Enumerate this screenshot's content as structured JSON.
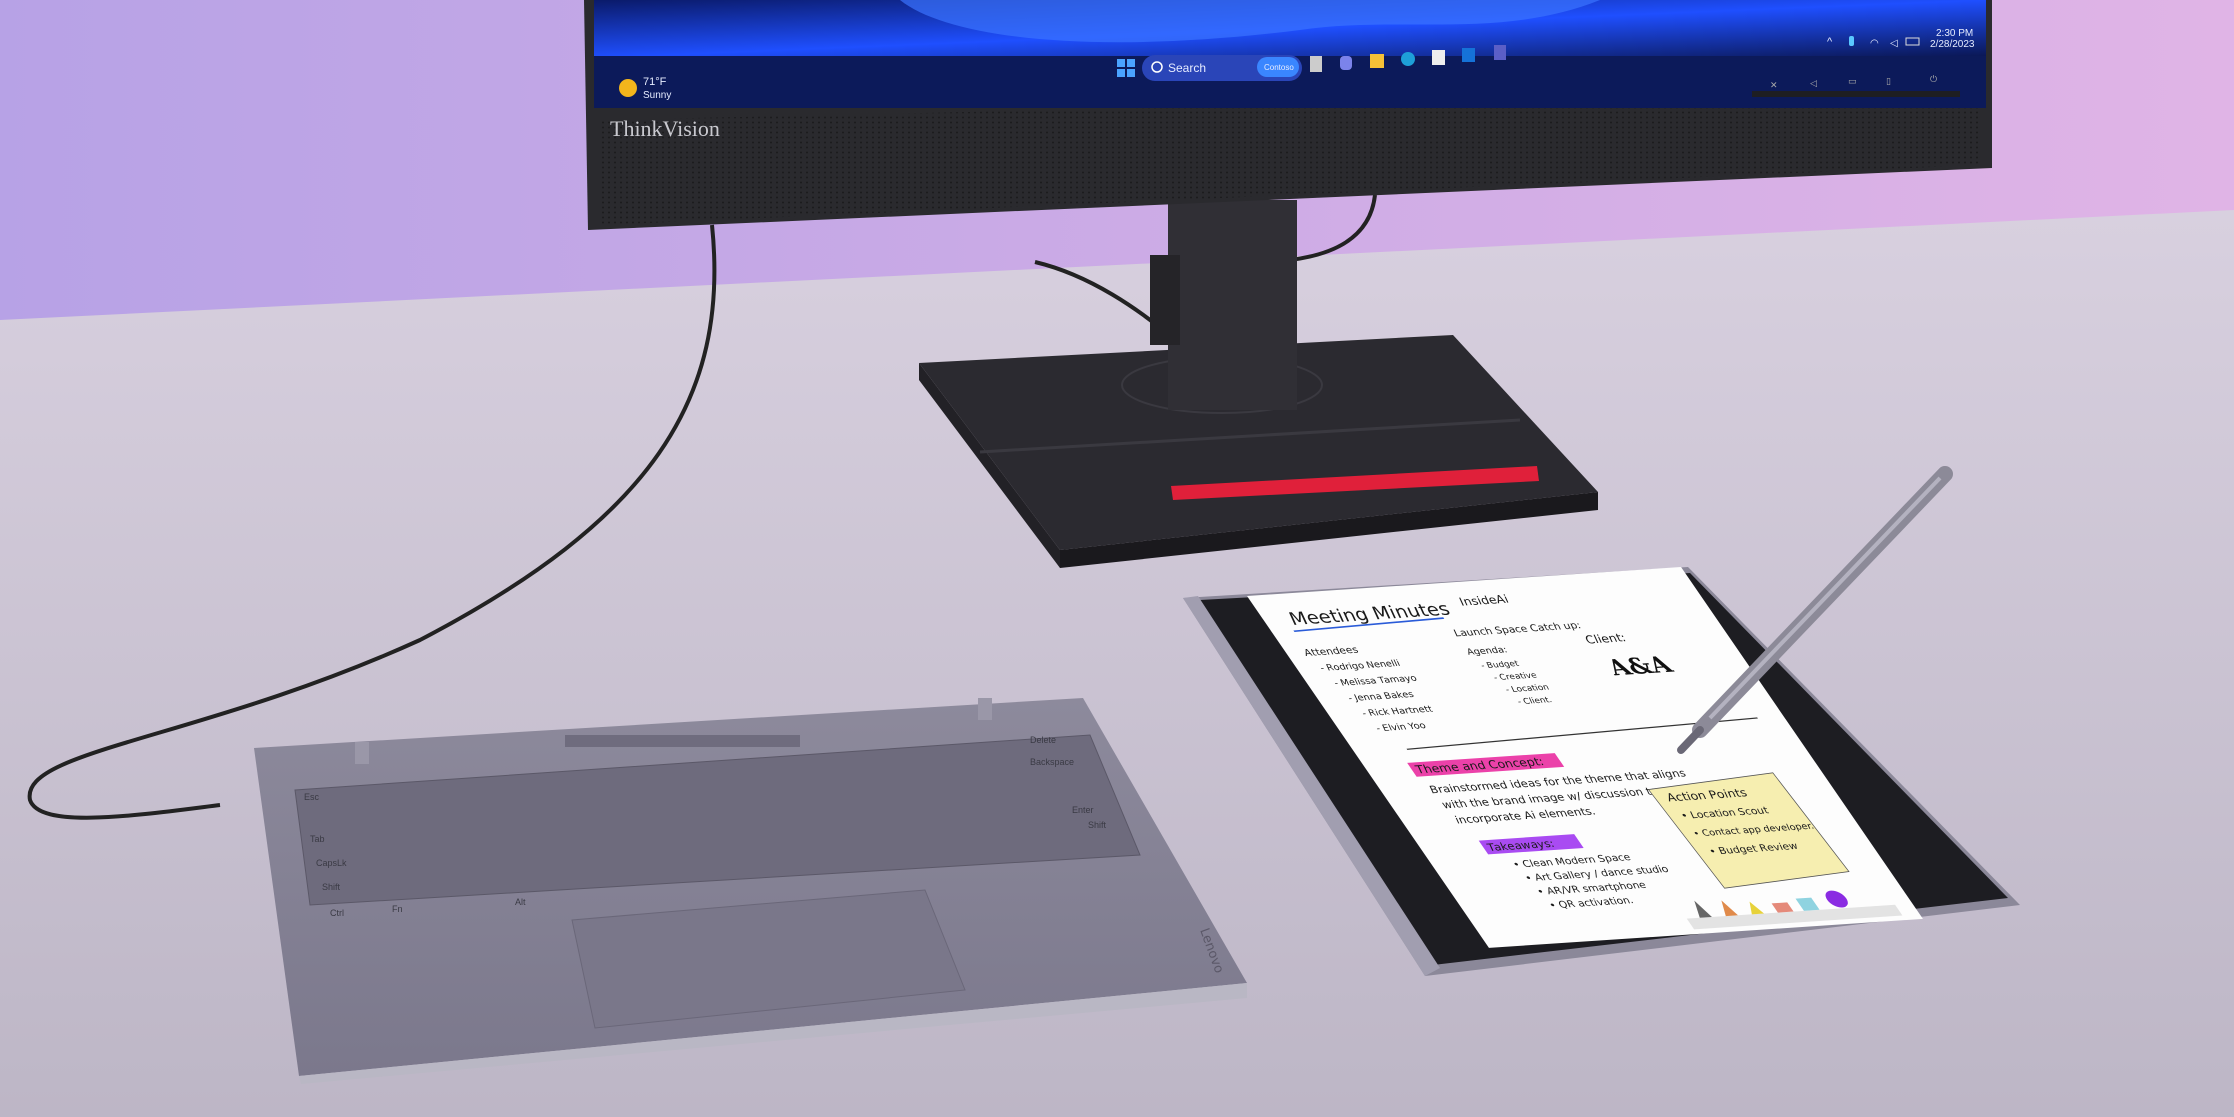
{
  "monitor": {
    "brand": "ThinkVision",
    "taskbar": {
      "weather_temp": "71°F",
      "weather_condition": "Sunny",
      "weather_icon": "sun-icon",
      "search_placeholder": "Search",
      "search_badge": "Contoso",
      "time": "2:30 PM",
      "date": "2/28/2023",
      "pinned_apps": [
        "windows-start-icon",
        "task-view-icon",
        "teams-chat-icon",
        "file-explorer-icon",
        "edge-icon",
        "store-icon",
        "outlook-icon",
        "teams-icon"
      ],
      "tray_icons": [
        "chevron-up-icon",
        "microphone-icon",
        "wifi-icon",
        "volume-icon",
        "battery-icon"
      ]
    },
    "accent_color": "#1f4fff",
    "stand_light_color": "#e0203a"
  },
  "keyboard": {
    "keys": {
      "esc": "Esc",
      "tab": "Tab",
      "caps": "CapsLk",
      "shift": "Shift",
      "ctrl": "Ctrl",
      "fn": "Fn",
      "alt": "Alt",
      "enter": "Enter",
      "backspace": "Backspace",
      "shift_right": "Shift",
      "delete": "Delete"
    },
    "logo": "Lenovo"
  },
  "tablet_note": {
    "title": "Meeting Minutes",
    "org": "InsideAi",
    "subtitle": "Launch Space Catch up:",
    "attendees_label": "Attendees",
    "attendees": [
      "- Rodrigo Nenelli",
      "- Melissa Tamayo",
      "- Jenna Bakes",
      "- Rick Hartnett",
      "- Elvin Yoo"
    ],
    "agenda_label": "Agenda:",
    "agenda": [
      "- Budget",
      "- Creative",
      "- Location",
      "- Client."
    ],
    "client_label": "Client:",
    "client_logo": "A&A",
    "theme_label": "Theme and Concept:",
    "theme_lines": [
      "Brainstormed ideas for the theme that aligns",
      "with the brand image w/ discussion to",
      "incorporate Ai elements."
    ],
    "takeaways_label": "Takeaways:",
    "takeaways": [
      "• Clean Modern Space",
      "• Art Gallery / dance studio",
      "• AR/VR smartphone",
      "• QR activation."
    ],
    "action_points": {
      "title": "Action Points",
      "items": [
        "• Location Scout",
        "• Contact app developer.",
        "• Budget Review"
      ]
    },
    "highlight_colors": {
      "theme": "#e8209a",
      "takeaways": "#9a2cf0"
    },
    "tools": [
      "pen-tool-icon",
      "pencil-tool-icon",
      "highlighter-tool-icon",
      "eraser-tool-icon",
      "ruler-tool-icon",
      "color-swatch-icon"
    ]
  }
}
